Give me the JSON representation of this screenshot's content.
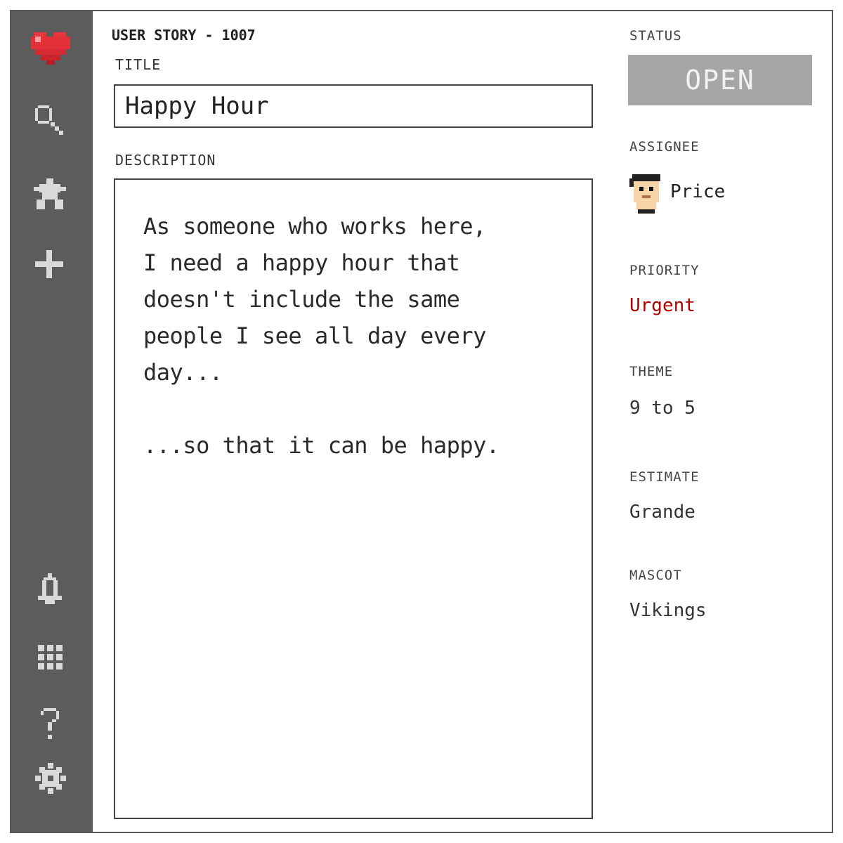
{
  "story": {
    "id_label": "USER STORY - 1007"
  },
  "title": {
    "label": "TITLE",
    "value": "Happy Hour"
  },
  "description": {
    "label": "DESCRIPTION",
    "value": "As someone who works here,\nI need a happy hour that\ndoesn't include the same\npeople I see all day every\nday...\n\n...so that it can be happy."
  },
  "status": {
    "label": "STATUS",
    "value": "OPEN"
  },
  "assignee": {
    "label": "ASSIGNEE",
    "name": "Price"
  },
  "priority": {
    "label": "PRIORITY",
    "value": "Urgent",
    "color": "#b00000"
  },
  "theme": {
    "label": "THEME",
    "value": "9 to 5"
  },
  "estimate": {
    "label": "ESTIMATE",
    "value": "Grande"
  },
  "mascot": {
    "label": "MASCOT",
    "value": "Vikings"
  },
  "sidebar": {
    "icons": [
      "heart-logo-icon",
      "search-icon",
      "puzzle-icon",
      "plus-icon",
      "bell-icon",
      "grid-icon",
      "help-icon",
      "gear-icon"
    ]
  },
  "colors": {
    "sidebar_bg": "#5c5c5c",
    "status_bg": "#a6a6a6",
    "accent_heart": "#e8343c"
  }
}
